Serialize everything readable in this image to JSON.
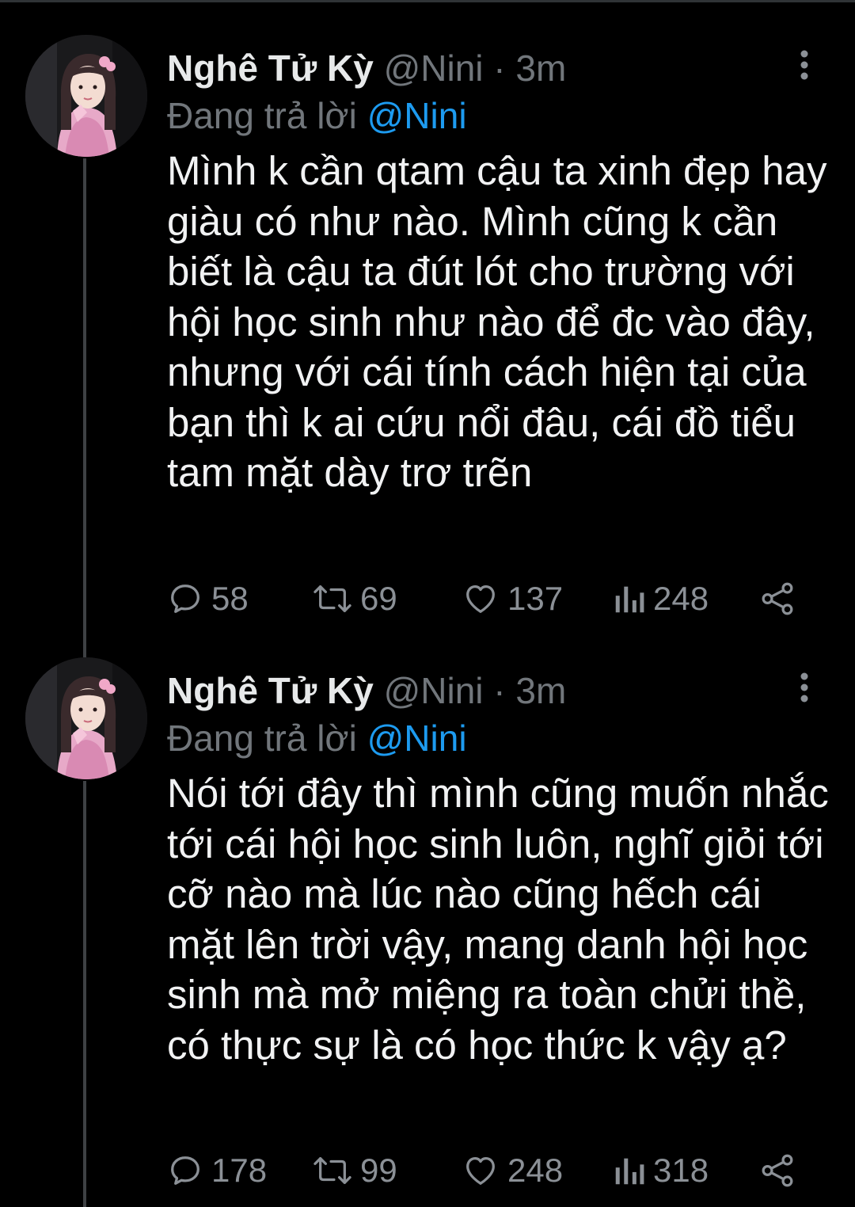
{
  "tweets": [
    {
      "author_name": "Nghê Tử Kỳ",
      "handle": "@Nini",
      "separator": "·",
      "time": "3m",
      "reply_prefix": "Đang trả lời",
      "reply_to": "@Nini",
      "text": "Mình k cần qtam cậu ta xinh đẹp hay giàu có như nào. Mình cũng k cần biết là cậu ta đút lót cho trường với hội học sinh như nào để đc vào đây, nhưng với cái tính cách hiện tại của bạn thì k ai cứu nổi đâu, cái đồ tiểu tam mặt dày trơ trẽn",
      "replies": "58",
      "retweets": "69",
      "likes": "137",
      "views": "248"
    },
    {
      "author_name": "Nghê Tử Kỳ",
      "handle": "@Nini",
      "separator": "·",
      "time": "3m",
      "reply_prefix": "Đang trả lời",
      "reply_to": "@Nini",
      "text": "Nói tới đây thì mình cũng muốn nhắc tới cái hội học sinh luôn, nghĩ giỏi tới cỡ nào mà lúc nào cũng hếch cái mặt lên trời vậy, mang danh hội học sinh mà mở miệng ra toàn chửi thề, có thực sự là có học thức k vậy ạ?",
      "replies": "178",
      "retweets": "99",
      "likes": "248",
      "views": "318"
    }
  ],
  "icons": {
    "reply": "reply-icon",
    "retweet": "retweet-icon",
    "like": "heart-icon",
    "views": "views-icon",
    "share": "share-icon",
    "more": "more-vertical-icon"
  },
  "colors": {
    "background": "#000000",
    "text": "#e7e9ea",
    "secondary": "#71767b",
    "link": "#1d9bf0",
    "thread_line": "#3e4144"
  }
}
